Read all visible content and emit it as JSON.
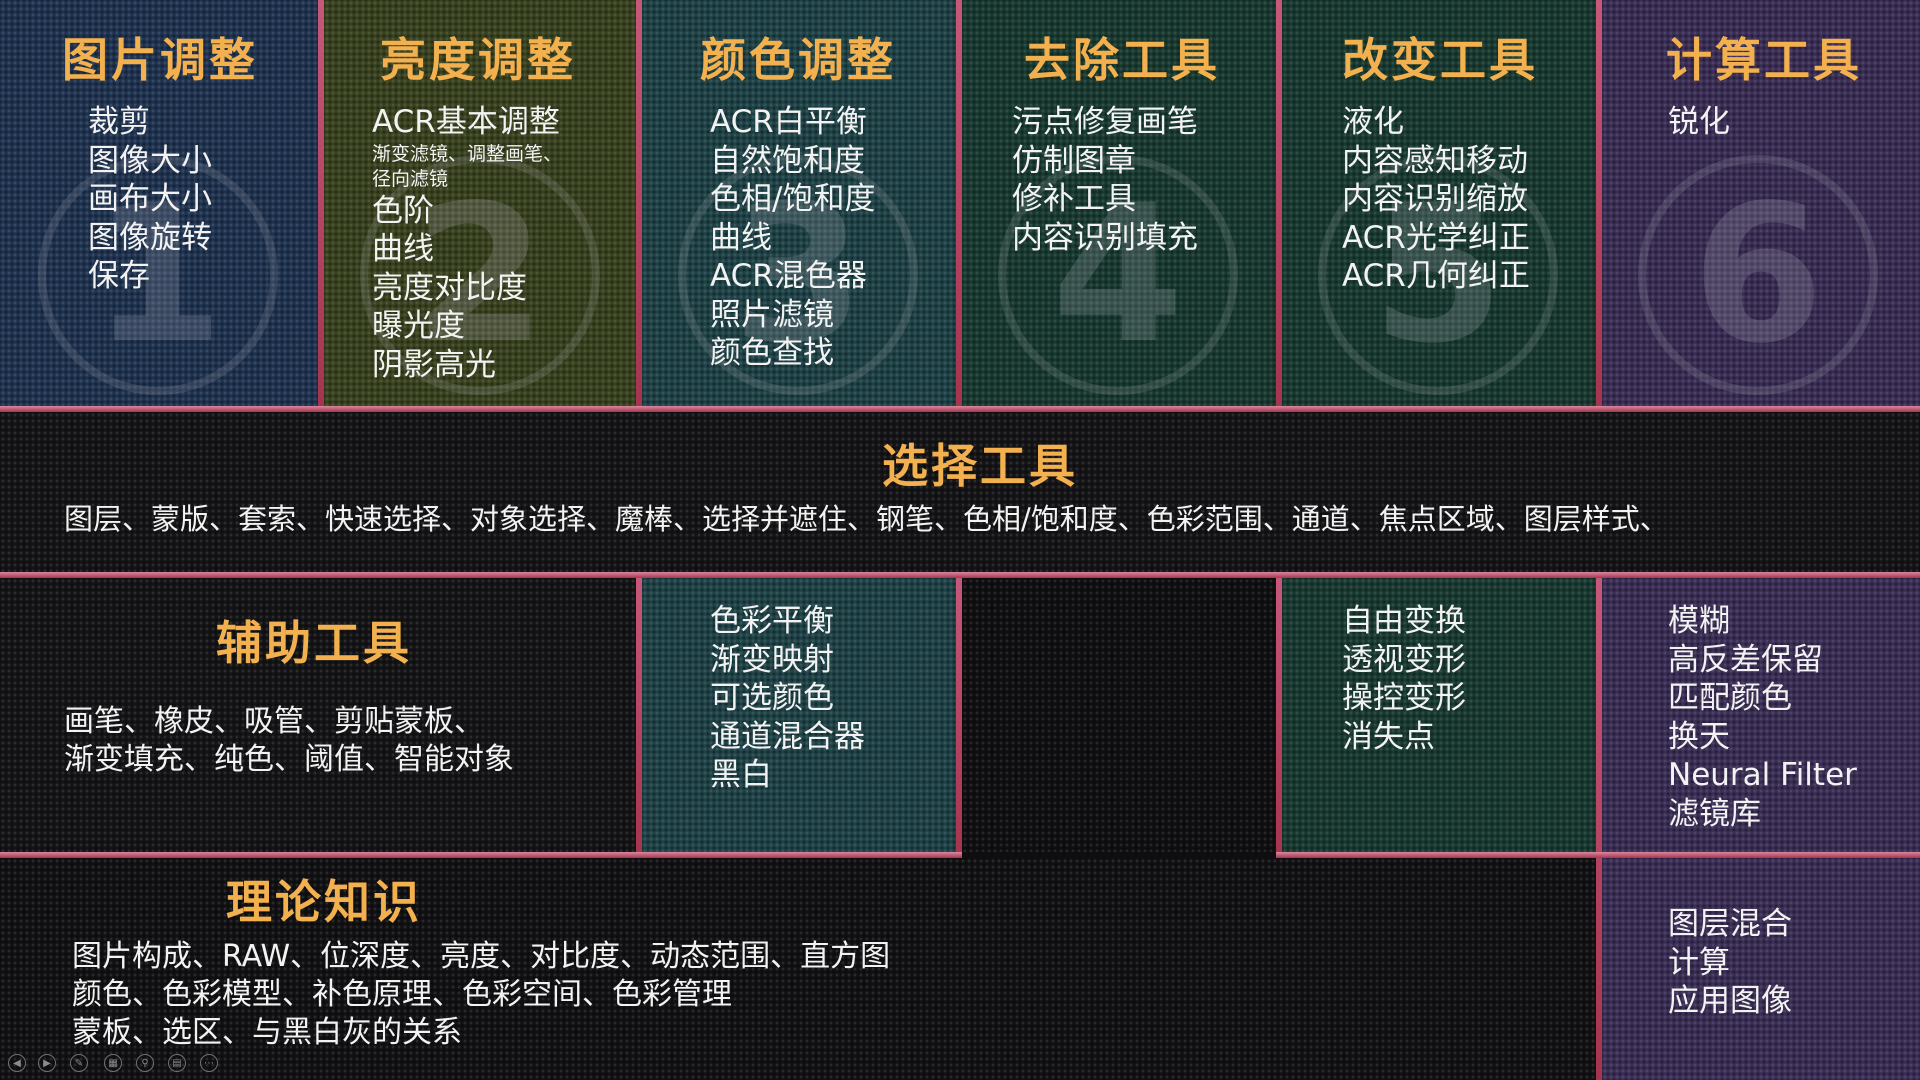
{
  "columns": [
    {
      "title": "图片调整",
      "number": "1",
      "items": [
        "裁剪",
        "图像大小",
        "画布大小",
        "图像旋转",
        "保存"
      ]
    },
    {
      "title": "亮度调整",
      "number": "2",
      "items": [
        "ACR基本调整",
        "渐变滤镜、调整画笔、",
        "径向滤镜",
        "色阶",
        "曲线",
        "亮度对比度",
        "曝光度",
        "阴影高光"
      ]
    },
    {
      "title": "颜色调整",
      "number": "3",
      "items": [
        "ACR白平衡",
        "自然饱和度",
        "色相/饱和度",
        "曲线",
        "ACR混色器",
        "照片滤镜",
        "颜色查找"
      ]
    },
    {
      "title": "去除工具",
      "number": "4",
      "items": [
        "污点修复画笔",
        "仿制图章",
        "修补工具",
        "内容识别填充"
      ]
    },
    {
      "title": "改变工具",
      "number": "5",
      "items": [
        "液化",
        "内容感知移动",
        "内容识别缩放",
        "ACR光学纠正",
        "ACR几何纠正"
      ]
    },
    {
      "title": "计算工具",
      "number": "6",
      "items": [
        "锐化"
      ]
    }
  ],
  "selection": {
    "title": "选择工具",
    "text": "图层、蒙版、套索、快速选择、对象选择、魔棒、选择并遮住、钢笔、色相/饱和度、色彩范围、通道、焦点区域、图层样式、"
  },
  "auxiliary": {
    "title": "辅助工具",
    "lines": [
      "画笔、橡皮、吸管、剪贴蒙板、",
      "渐变填充、纯色、阈值、智能对象"
    ]
  },
  "color_extra": {
    "items": [
      "色彩平衡",
      "渐变映射",
      "可选颜色",
      "通道混合器",
      "黑白"
    ]
  },
  "change_extra": {
    "items": [
      "自由变换",
      "透视变形",
      "操控变形",
      "消失点"
    ]
  },
  "compute_extra": {
    "items": [
      "模糊",
      "高反差保留",
      "匹配颜色",
      "换天",
      "Neural Filter",
      "滤镜库"
    ]
  },
  "compute_extra2": {
    "items": [
      "图层混合",
      "计算",
      "应用图像"
    ]
  },
  "theory": {
    "title": "理论知识",
    "lines": [
      "图片构成、RAW、位深度、亮度、对比度、动态范围、直方图",
      "颜色、色彩模型、补色原理、色彩空间、色彩管理",
      "蒙板、选区、与黑白灰的关系"
    ]
  },
  "controls": [
    "previous-icon",
    "next-icon",
    "pen-icon",
    "slides-icon",
    "zoom-icon",
    "subtitle-icon",
    "more-icon"
  ],
  "colors": {
    "accent_title": "#f3b04e",
    "divider": "#b63d5c",
    "col1": "#1f3350",
    "col2": "#39421f",
    "col3": "#1f4247",
    "col4": "#193a31",
    "col5": "#193a31",
    "col6": "#3a2e55"
  }
}
